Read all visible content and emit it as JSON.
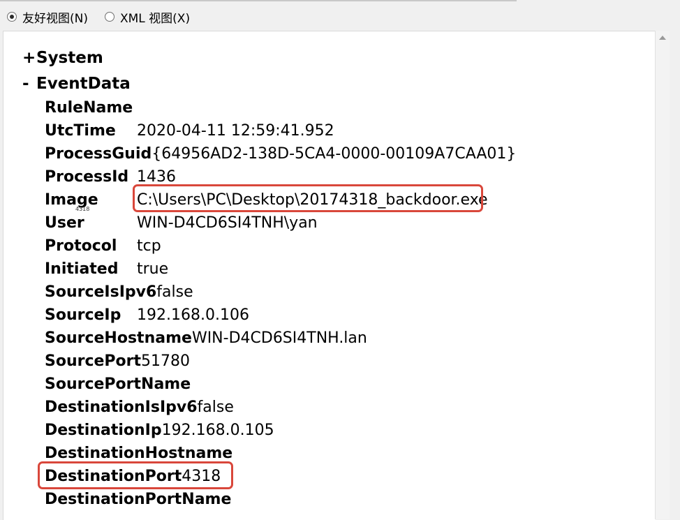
{
  "view_options": {
    "friendly_label": "友好视图(N)",
    "xml_label": "XML 视图(X)",
    "selected": "friendly"
  },
  "tree": {
    "system": {
      "toggle": "+",
      "label": "System"
    },
    "eventdata": {
      "toggle": "-",
      "label": "EventData"
    },
    "fields": [
      {
        "name": "RuleName",
        "value": ""
      },
      {
        "name": "UtcTime",
        "value": "2020-04-11 12:59:41.952"
      },
      {
        "name": "ProcessGuid",
        "value": "{64956AD2-138D-5CA4-0000-00109A7CAA01}"
      },
      {
        "name": "ProcessId",
        "value": "1436"
      },
      {
        "name": "Image",
        "value": "C:\\Users\\PC\\Desktop\\20174318_backdoor.exe"
      },
      {
        "name": "User",
        "value": "WIN-D4CD6SI4TNH\\yan"
      },
      {
        "name": "Protocol",
        "value": "tcp"
      },
      {
        "name": "Initiated",
        "value": "true"
      },
      {
        "name": "SourceIsIpv6",
        "value": "false"
      },
      {
        "name": "SourceIp",
        "value": "192.168.0.106"
      },
      {
        "name": "SourceHostname",
        "value": "WIN-D4CD6SI4TNH.lan"
      },
      {
        "name": "SourcePort",
        "value": "51780"
      },
      {
        "name": "SourcePortName",
        "value": ""
      },
      {
        "name": "DestinationIsIpv6",
        "value": "false"
      },
      {
        "name": "DestinationIp",
        "value": "192.168.0.105"
      },
      {
        "name": "DestinationHostname",
        "value": ""
      },
      {
        "name": "DestinationPort",
        "value": "4318"
      },
      {
        "name": "DestinationPortName",
        "value": ""
      }
    ]
  },
  "annotation_note": "4318",
  "colors": {
    "highlight": "#d9473b"
  }
}
